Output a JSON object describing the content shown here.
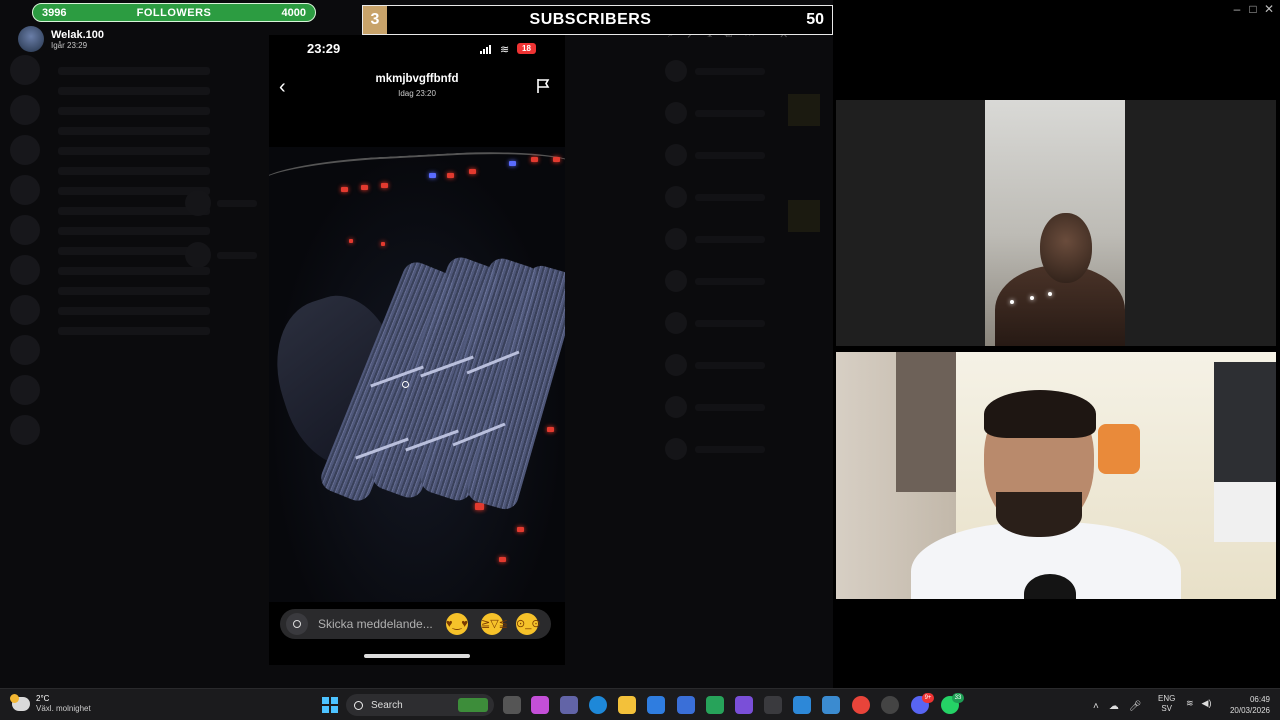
{
  "overlay": {
    "followers": {
      "current": "3996",
      "label": "FOLLOWERS",
      "goal": "4000"
    },
    "subscribers": {
      "current": "3",
      "label": "SUBSCRIBERS",
      "goal": "50"
    }
  },
  "story_user": {
    "name": "Welak.100",
    "time": "Igår 23:29"
  },
  "phone": {
    "clock": "23:29",
    "battery": "18",
    "sender": "mkmjbvgffbnfd",
    "sent_time": "Idag 23:20",
    "message_placeholder": "Skicka meddelande...",
    "reactions": [
      "heart-eyes-emoji",
      "laughing-tears-emoji",
      "flushed-emoji"
    ]
  },
  "taskbar": {
    "weather_temp": "2°C",
    "weather_condition": "Växl. molnighet",
    "search_label": "Search",
    "apps": [
      {
        "name": "file-explorer-icon",
        "color": "#f3c13a"
      },
      {
        "name": "microsoft-store-icon",
        "color": "#2f7de0"
      },
      {
        "name": "vpn-shield-icon",
        "color": "#27a35a"
      },
      {
        "name": "chrome-icon",
        "color": "#e8443a"
      },
      {
        "name": "discord-icon",
        "color": "#5865f2"
      },
      {
        "name": "whatsapp-icon",
        "color": "#25d366"
      }
    ],
    "discord_badge": "9+",
    "whatsapp_badge": "33",
    "language_primary": "ENG",
    "language_secondary": "SV",
    "time": "06:49",
    "date": "20/03/2026"
  }
}
